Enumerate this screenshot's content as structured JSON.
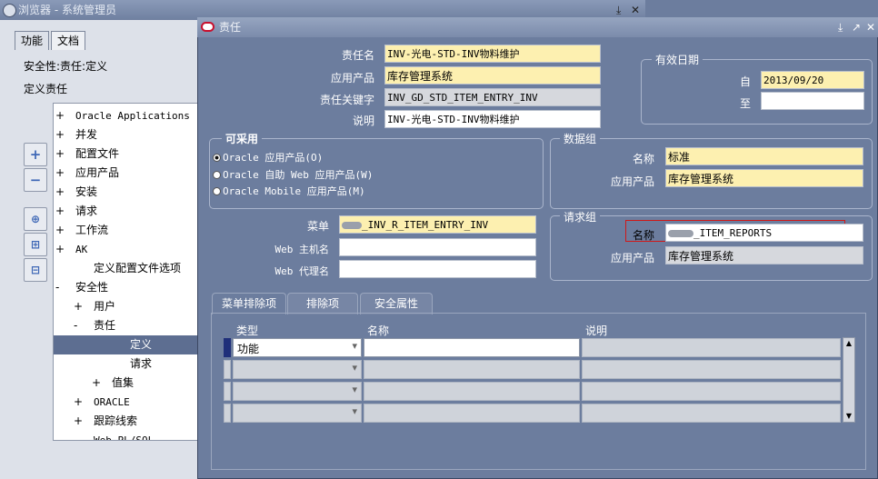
{
  "navigator": {
    "title": "浏览器 - 系统管理员",
    "tabs": [
      "功能",
      "文档"
    ],
    "path": "安全性:责任:定义",
    "current": "定义责任",
    "tree": [
      {
        "sign": "+",
        "label": "Oracle Applications",
        "depth": 0
      },
      {
        "sign": "+",
        "label": "并发",
        "depth": 0
      },
      {
        "sign": "+",
        "label": "配置文件",
        "depth": 0
      },
      {
        "sign": "+",
        "label": "应用产品",
        "depth": 0
      },
      {
        "sign": "+",
        "label": "安装",
        "depth": 0
      },
      {
        "sign": "+",
        "label": "请求",
        "depth": 0
      },
      {
        "sign": "+",
        "label": "工作流",
        "depth": 0
      },
      {
        "sign": "+",
        "label": "AK",
        "depth": 0
      },
      {
        "sign": "",
        "label": "定义配置文件选项",
        "depth": 1
      },
      {
        "sign": "-",
        "label": "安全性",
        "depth": 0
      },
      {
        "sign": "+",
        "label": "用户",
        "depth": 1
      },
      {
        "sign": "-",
        "label": "责任",
        "depth": 1
      },
      {
        "sign": "",
        "label": "定义",
        "depth": 3,
        "selected": true
      },
      {
        "sign": "",
        "label": "请求",
        "depth": 3
      },
      {
        "sign": "+",
        "label": "值集",
        "depth": 2
      },
      {
        "sign": "+",
        "label": "ORACLE",
        "depth": 1
      },
      {
        "sign": "+",
        "label": "跟踪线索",
        "depth": 1
      },
      {
        "sign": "",
        "label": "Web PL/SQL",
        "depth": 1
      }
    ]
  },
  "form": {
    "title": "责任",
    "responsibility_name_label": "责任名",
    "responsibility_name": "INV-光电-STD-INV物料维护",
    "application_label": "应用产品",
    "application": "库存管理系统",
    "key_label": "责任关键字",
    "key": "INV_GD_STD_ITEM_ENTRY_INV",
    "description_label": "说明",
    "description": "INV-光电-STD-INV物料维护",
    "effective_dates": {
      "title": "有效日期",
      "from_label": "自",
      "from": "2013/09/20",
      "to_label": "至",
      "to": ""
    },
    "available": {
      "title": "可采用",
      "options": [
        "Oracle 应用产品(O)",
        "Oracle 自助 Web 应用产品(W)",
        "Oracle Mobile 应用产品(M)"
      ]
    },
    "data_group": {
      "title": "数据组",
      "name_label": "名称",
      "name": "标准",
      "app_label": "应用产品",
      "app": "库存管理系统"
    },
    "menu_label": "菜单",
    "menu": "_INV_R_ITEM_ENTRY_INV",
    "web_host_label": "Web 主机名",
    "web_host": "",
    "web_agent_label": "Web 代理名",
    "web_agent": "",
    "request_group": {
      "title": "请求组",
      "name_label": "名称",
      "name": "_ITEM_REPORTS",
      "app_label": "应用产品",
      "app": "库存管理系统"
    },
    "tabs": [
      "菜单排除项",
      "排除项",
      "安全属性"
    ],
    "grid": {
      "headers": [
        "类型",
        "名称",
        "说明"
      ],
      "first_type": "功能"
    }
  },
  "colors": {
    "background": "#6c7d9e",
    "required": "#fdf0b0",
    "highlight_box": "#d01818"
  }
}
